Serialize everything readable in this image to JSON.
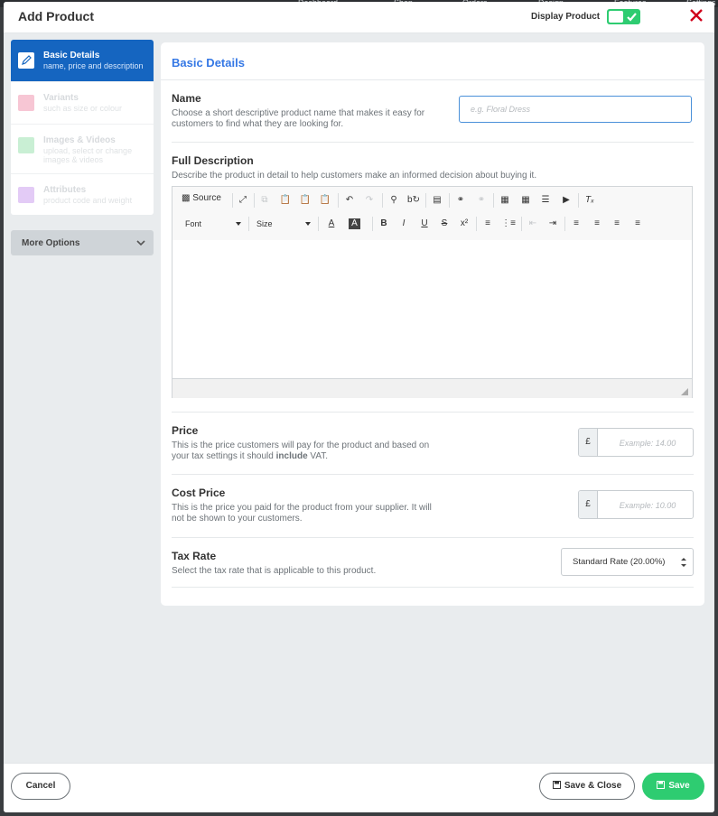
{
  "background_nav": [
    "Dashboard",
    "Shop",
    "Orders",
    "Design",
    "Features",
    "Settings"
  ],
  "modal": {
    "title": "Add Product",
    "display_product_label": "Display Product",
    "display_product_on": true
  },
  "sidebar": {
    "items": [
      {
        "title": "Basic Details",
        "subtitle": "name, price and description",
        "active": true,
        "icon": "pencil-icon"
      },
      {
        "title": "Variants",
        "subtitle": "such as size or colour",
        "active": false,
        "icon": "variants-icon"
      },
      {
        "title": "Images & Videos",
        "subtitle": "upload, select or change images & videos",
        "active": false,
        "icon": "images-icon"
      },
      {
        "title": "Attributes",
        "subtitle": "product code and weight",
        "active": false,
        "icon": "attributes-icon"
      }
    ],
    "more_options": "More Options"
  },
  "panel": {
    "title": "Basic Details",
    "name": {
      "label": "Name",
      "help": "Choose a short descriptive product name that makes it easy for customers to find what they are looking for.",
      "placeholder": "e.g. Floral Dress",
      "value": ""
    },
    "description": {
      "label": "Full Description",
      "help": "Describe the product in detail to help customers make an informed decision about buying it.",
      "toolbar": {
        "source_label": "Source",
        "font_label": "Font",
        "size_label": "Size"
      }
    },
    "price": {
      "label": "Price",
      "help_1": "This is the price customers will pay for the product and based on your tax settings it should ",
      "help_bold": "include",
      "help_2": " VAT.",
      "currency": "£",
      "placeholder": "Example: 14.00"
    },
    "cost_price": {
      "label": "Cost Price",
      "help": "This is the price you paid for the product from your supplier. It will not be shown to your customers.",
      "currency": "£",
      "placeholder": "Example: 10.00"
    },
    "tax_rate": {
      "label": "Tax Rate",
      "help": "Select the tax rate that is applicable to this product.",
      "selected": "Standard Rate (20.00%)"
    }
  },
  "footer": {
    "cancel": "Cancel",
    "save_close": "Save & Close",
    "save": "Save"
  },
  "colors": {
    "accent_blue": "#1565c0",
    "title_blue": "#3578e5",
    "success_green": "#2ecc71",
    "close_red": "#d0021b"
  }
}
